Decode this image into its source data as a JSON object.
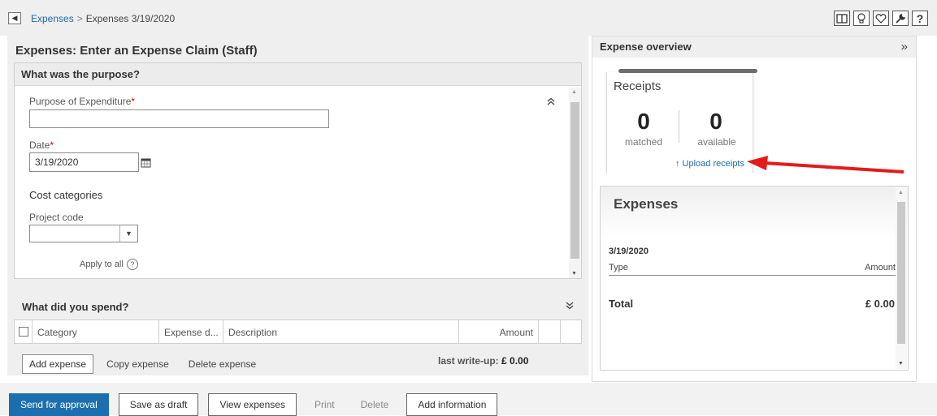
{
  "breadcrumb": {
    "parent": "Expenses",
    "separator": ">",
    "current": "Expenses 3/19/2020"
  },
  "page_title": "Expenses: Enter an Expense Claim (Staff)",
  "purpose": {
    "header": "What was the purpose?",
    "purpose_label": "Purpose of Expenditure",
    "purpose_value": "",
    "date_label": "Date",
    "date_value": "3/19/2020",
    "required_mark": "*",
    "cost_categories": "Cost categories",
    "project_code_label": "Project code",
    "project_code_value": "",
    "apply_to_all": "Apply to all",
    "help": "?"
  },
  "spend": {
    "header": "What did you spend?",
    "columns": [
      "Category",
      "Expense d...",
      "Description",
      "Amount"
    ],
    "add_expense": "Add expense",
    "copy_expense": "Copy expense",
    "delete_expense": "Delete expense",
    "last_writeup_label": "last write-up:",
    "last_writeup_value": "£ 0.00"
  },
  "overview": {
    "header": "Expense overview",
    "expand": "»",
    "receipts": {
      "title": "Receipts",
      "matched_count": "0",
      "matched_label": "matched",
      "available_count": "0",
      "available_label": "available",
      "upload_link": "↑ Upload receipts"
    },
    "expenses": {
      "title": "Expenses",
      "date": "3/19/2020",
      "type_col": "Type",
      "amount_col": "Amount",
      "total_label": "Total",
      "total_value": "£ 0.00"
    }
  },
  "actions": {
    "send": "Send for approval",
    "save_draft": "Save as draft",
    "view_expenses": "View expenses",
    "print": "Print",
    "delete": "Delete",
    "add_info": "Add information"
  },
  "colors": {
    "accent": "#1c6fae",
    "link": "#1b6aa5",
    "arrow": "#e31b1b"
  },
  "icons": [
    "back-arrow-icon",
    "panel-layout-icon",
    "lightbulb-icon",
    "heart-icon",
    "wrench-icon",
    "help-icon",
    "calendar-icon",
    "chevron-down-icon",
    "double-chevron-up-icon",
    "double-chevron-down-icon"
  ]
}
